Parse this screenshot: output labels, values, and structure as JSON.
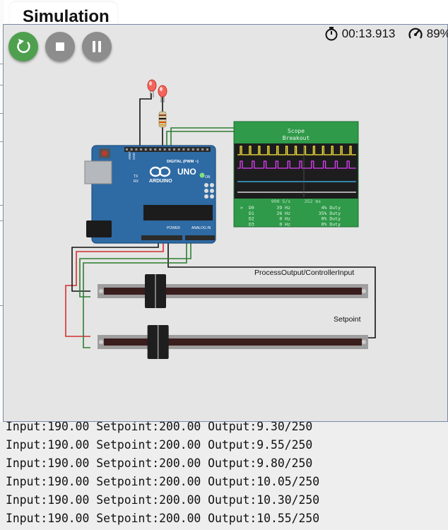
{
  "tab": {
    "title": "Simulation"
  },
  "toolbar": {
    "restart_icon": "restart-icon",
    "stop_icon": "stop-icon",
    "pause_icon": "pause-icon",
    "timer_icon": "stopwatch-icon",
    "timer": "00:13.913",
    "perf_icon": "speedometer-icon",
    "performance": "89%"
  },
  "arduino": {
    "brand": "ARDUINO",
    "model": "UNO",
    "digital_label": "DIGITAL (PWM ~)",
    "power_label": "POWER",
    "analog_label": "ANALOG IN",
    "tx": "TX",
    "rx": "RX",
    "on": "ON",
    "aref_label": "AREF",
    "gnd_label": "GND"
  },
  "scope": {
    "title_line1": "Scope",
    "title_line2": "Breakout",
    "header": "990 S/s     252 ms",
    "rows": [
      {
        "marker": ">",
        "ch": "D0",
        "freq": "39 Hz",
        "duty": "4% Duty"
      },
      {
        "marker": "",
        "ch": "D1",
        "freq": "26 Hz",
        "duty": "35% Duty"
      },
      {
        "marker": "",
        "ch": "D2",
        "freq": "0 Hz",
        "duty": "0% Duty"
      },
      {
        "marker": "",
        "ch": "D3",
        "freq": "0 Hz",
        "duty": "0% Duty"
      }
    ],
    "trace_colors": [
      "#ffeb3b",
      "#e040fb",
      "#40c4ff",
      "#ffffff"
    ]
  },
  "sliders": [
    {
      "label": "ProcessOutput/ControllerInput",
      "position": 0.2
    },
    {
      "label": "Setpoint",
      "position": 0.21
    }
  ],
  "serial": {
    "lines": [
      "Input:190.00 Setpoint:200.00 Output:9.30/250",
      "Input:190.00 Setpoint:200.00 Output:9.55/250",
      "Input:190.00 Setpoint:200.00 Output:9.80/250",
      "Input:190.00 Setpoint:200.00 Output:10.05/250",
      "Input:190.00 Setpoint:200.00 Output:10.30/250",
      "Input:190.00 Setpoint:200.00 Output:10.55/250"
    ]
  }
}
